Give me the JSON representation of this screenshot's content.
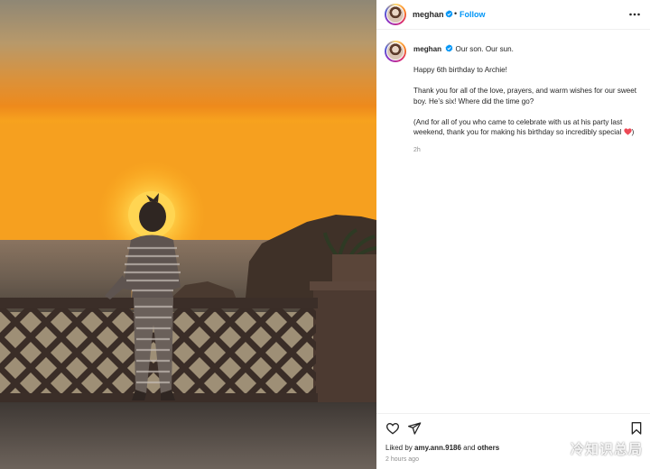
{
  "post": {
    "username": "meghan",
    "separator": "•",
    "follow_label": "Follow",
    "more_icon": "more-horizontal-icon",
    "verified_icon": "verified-badge-icon"
  },
  "caption": {
    "username": "meghan",
    "first_line": "Our son. Our sun.",
    "paragraph_1": "Happy 6th birthday to Archie!",
    "paragraph_2": "Thank you for all of the love, prayers, and warm wishes for our sweet boy. He’s six! Where did the time go?",
    "paragraph_3": "(And for all of you who came to celebrate with us at his party last weekend, thank you for making his birthday so incredibly special ",
    "paragraph_3_end": ")",
    "heart_emoji": "red-heart-icon",
    "time": "2h"
  },
  "actions": {
    "like_icon": "heart-outline-icon",
    "share_icon": "paper-plane-icon",
    "save_icon": "bookmark-icon"
  },
  "likes": {
    "prefix": "Liked by ",
    "user": "amy.ann.9186",
    "middle": " and ",
    "others": "others"
  },
  "post_time": "2 hours ago",
  "watermark": "冷知识总局",
  "colors": {
    "accent": "#0095f6",
    "text": "#262626",
    "secondary": "#8e8e8e",
    "heart": "#ed4956"
  }
}
